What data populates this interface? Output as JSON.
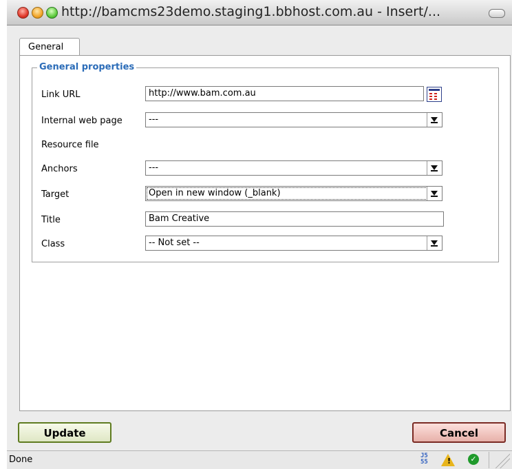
{
  "window": {
    "title": "http://bamcms23demo.staging1.bbhost.com.au - Insert/..."
  },
  "tabs": [
    {
      "label": "General"
    }
  ],
  "fieldset": {
    "legend": "General properties"
  },
  "form": {
    "link_url": {
      "label": "Link URL",
      "value": "http://www.bam.com.au"
    },
    "internal_page": {
      "label": "Internal web page",
      "value": "---"
    },
    "resource_file": {
      "label": "Resource file"
    },
    "anchors": {
      "label": "Anchors",
      "value": "---"
    },
    "target": {
      "label": "Target",
      "value": "Open in new window (_blank)"
    },
    "title": {
      "label": "Title",
      "value": "Bam Creative"
    },
    "class": {
      "label": "Class",
      "value": "-- Not set --"
    }
  },
  "buttons": {
    "update": "Update",
    "cancel": "Cancel"
  },
  "statusbar": {
    "text": "Done",
    "icons": [
      "js-icon",
      "warning-icon",
      "ok-icon",
      "resize-grip-icon"
    ]
  },
  "colors": {
    "legend": "#2b6cb8",
    "update_border": "#5e7b1f",
    "cancel_border": "#7a2a23"
  }
}
